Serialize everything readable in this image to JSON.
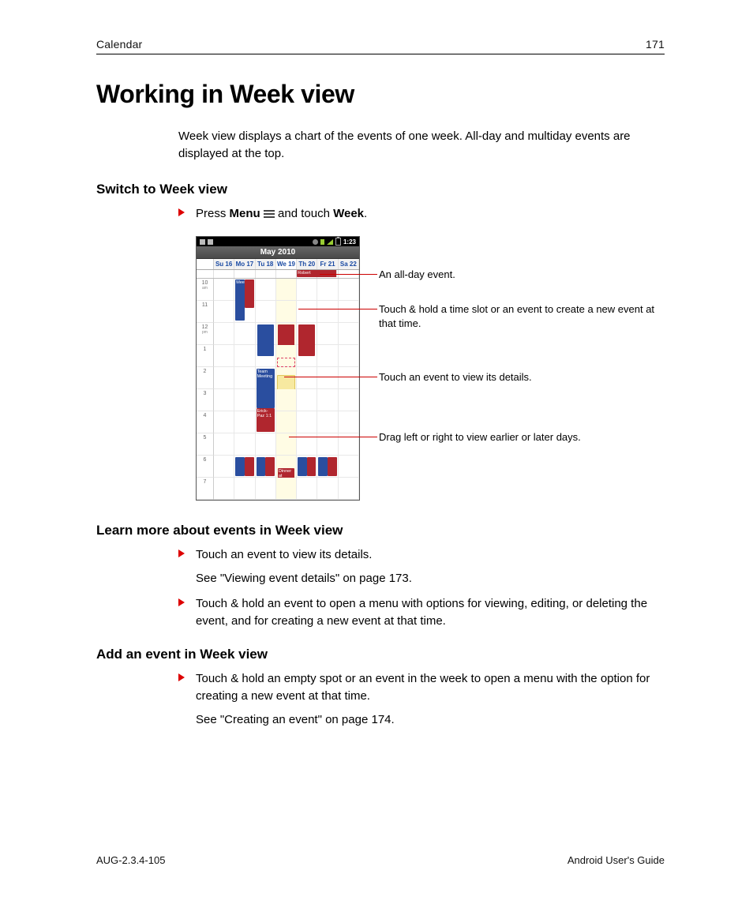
{
  "header": {
    "section_name": "Calendar",
    "page_number": "171"
  },
  "title": "Working in Week view",
  "intro": "Week view displays a chart of the events of one week. All-day and multiday events are displayed at the top.",
  "sections": {
    "switch": {
      "title": "Switch to Week view",
      "bullet1_pre": "Press ",
      "bullet1_menu": "Menu",
      "bullet1_mid": " and touch ",
      "bullet1_week": "Week",
      "bullet1_post": "."
    },
    "learn": {
      "title": "Learn more about events in Week view",
      "b1": "Touch an event to view its details.",
      "b1_sub": "See \"Viewing event details\" on page 173.",
      "b2": "Touch & hold an event to open a menu with options for viewing, editing, or deleting the event, and for creating a new event at that time."
    },
    "add": {
      "title": "Add an event in Week view",
      "b1": "Touch & hold an empty spot or an event in the week to open a menu with the option for creating a new event at that time.",
      "b1_sub": "See \"Creating an event\" on page 174."
    }
  },
  "callouts": {
    "c1": "An all-day event.",
    "c2": "Touch & hold a time slot or an event to create a new event at that time.",
    "c3": "Touch an event to view its details.",
    "c4": "Drag left or right to view earlier or later days."
  },
  "phone": {
    "status_time": "1:23",
    "month_title": "May 2010",
    "days": [
      "Su 16",
      "Mo 17",
      "Tu 18",
      "We 19",
      "Th 20",
      "Fr 21",
      "Sa 22"
    ],
    "hours": [
      "10",
      "11",
      "12",
      "1",
      "2",
      "3",
      "4",
      "5",
      "6",
      "7"
    ],
    "ampm": [
      "am",
      "",
      "pm",
      "",
      "",
      "",
      "",
      "",
      "",
      ""
    ],
    "allday_label": "Robert",
    "events": {
      "meeting_10_mo": "Meeting",
      "team_meeting": "Team Meeting",
      "erick": "Erick-Paz 1:1",
      "dinner": "Dinner at Caroly"
    }
  },
  "footer": {
    "left": "AUG-2.3.4-105",
    "right": "Android User's Guide"
  }
}
